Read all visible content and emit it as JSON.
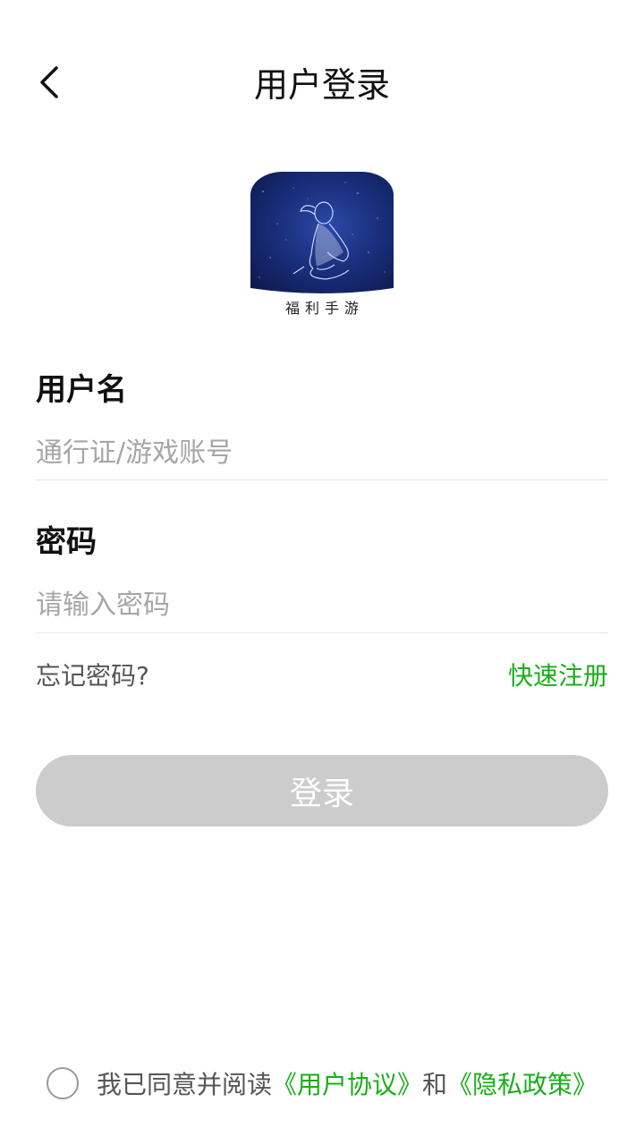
{
  "header": {
    "title": "用户登录",
    "back_icon": "chevron-left-icon"
  },
  "logo": {
    "caption": "福利手游"
  },
  "form": {
    "username_label": "用户名",
    "username_placeholder": "通行证/游戏账号",
    "username_value": "",
    "password_label": "密码",
    "password_placeholder": "请输入密码",
    "password_value": ""
  },
  "links": {
    "forgot_password": "忘记密码?",
    "quick_register": "快速注册"
  },
  "login_button": {
    "label": "登录"
  },
  "agreement": {
    "checked": false,
    "prefix": "我已同意并阅读",
    "user_agreement": "《用户协议》",
    "conjunction": "和",
    "privacy_policy": "《隐私政策》"
  },
  "colors": {
    "accent_green": "#1aad19",
    "button_disabled": "#cccccc",
    "placeholder_gray": "#a6a6a6"
  }
}
